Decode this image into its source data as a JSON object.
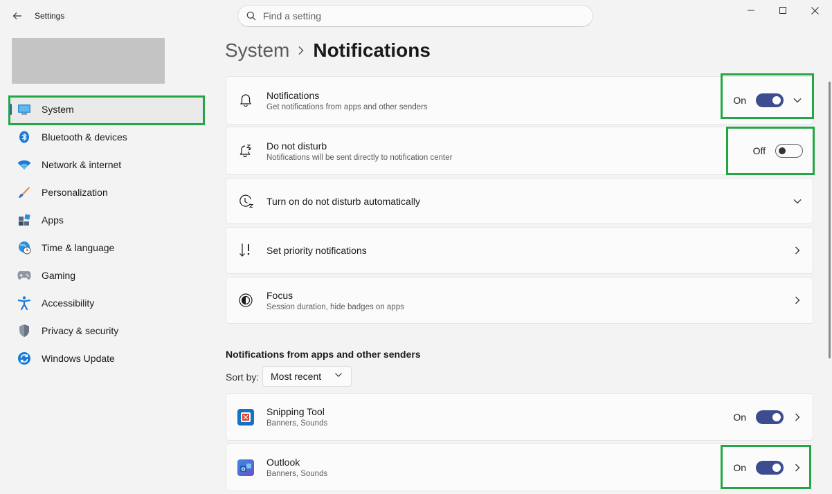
{
  "window": {
    "title": "Settings"
  },
  "search": {
    "placeholder": "Find a setting"
  },
  "sidebar": {
    "items": [
      {
        "label": "System",
        "icon": "monitor-icon",
        "active": true
      },
      {
        "label": "Bluetooth & devices",
        "icon": "bluetooth-icon"
      },
      {
        "label": "Network & internet",
        "icon": "wifi-icon"
      },
      {
        "label": "Personalization",
        "icon": "brush-icon"
      },
      {
        "label": "Apps",
        "icon": "apps-icon"
      },
      {
        "label": "Time & language",
        "icon": "globe-clock-icon"
      },
      {
        "label": "Gaming",
        "icon": "gamepad-icon"
      },
      {
        "label": "Accessibility",
        "icon": "accessibility-icon"
      },
      {
        "label": "Privacy & security",
        "icon": "shield-icon"
      },
      {
        "label": "Windows Update",
        "icon": "update-icon"
      }
    ]
  },
  "breadcrumb": {
    "parent": "System",
    "current": "Notifications"
  },
  "settings": {
    "notifications": {
      "title": "Notifications",
      "subtitle": "Get notifications from apps and other senders",
      "toggle_label": "On",
      "state": "on"
    },
    "dnd": {
      "title": "Do not disturb",
      "subtitle": "Notifications will be sent directly to notification center",
      "toggle_label": "Off",
      "state": "off"
    },
    "dnd_auto": {
      "title": "Turn on do not disturb automatically"
    },
    "priority": {
      "title": "Set priority notifications"
    },
    "focus": {
      "title": "Focus",
      "subtitle": "Session duration, hide badges on apps"
    }
  },
  "apps_section": {
    "title": "Notifications from apps and other senders",
    "sort_label": "Sort by:",
    "sort_value": "Most recent",
    "apps": [
      {
        "name": "Snipping Tool",
        "subtitle": "Banners, Sounds",
        "toggle_label": "On",
        "state": "on"
      },
      {
        "name": "Outlook",
        "subtitle": "Banners, Sounds",
        "toggle_label": "On",
        "state": "on"
      }
    ]
  },
  "colors": {
    "accent": "#3d4c8f",
    "highlight": "#22a744"
  }
}
